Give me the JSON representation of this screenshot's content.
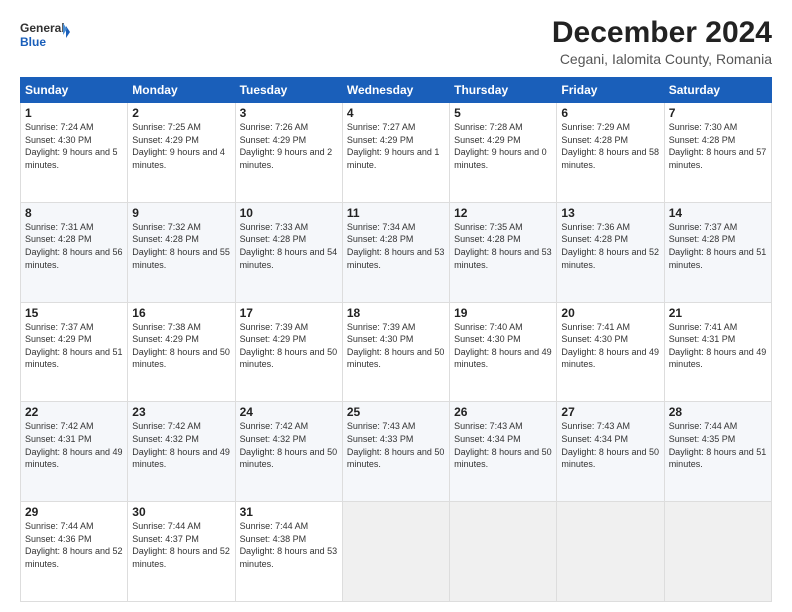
{
  "logo": {
    "line1": "General",
    "line2": "Blue"
  },
  "title": "December 2024",
  "subtitle": "Cegani, Ialomita County, Romania",
  "days_of_week": [
    "Sunday",
    "Monday",
    "Tuesday",
    "Wednesday",
    "Thursday",
    "Friday",
    "Saturday"
  ],
  "weeks": [
    [
      {
        "day": "1",
        "sunrise": "7:24 AM",
        "sunset": "4:30 PM",
        "daylight": "9 hours and 5 minutes."
      },
      {
        "day": "2",
        "sunrise": "7:25 AM",
        "sunset": "4:29 PM",
        "daylight": "9 hours and 4 minutes."
      },
      {
        "day": "3",
        "sunrise": "7:26 AM",
        "sunset": "4:29 PM",
        "daylight": "9 hours and 2 minutes."
      },
      {
        "day": "4",
        "sunrise": "7:27 AM",
        "sunset": "4:29 PM",
        "daylight": "9 hours and 1 minute."
      },
      {
        "day": "5",
        "sunrise": "7:28 AM",
        "sunset": "4:29 PM",
        "daylight": "9 hours and 0 minutes."
      },
      {
        "day": "6",
        "sunrise": "7:29 AM",
        "sunset": "4:28 PM",
        "daylight": "8 hours and 58 minutes."
      },
      {
        "day": "7",
        "sunrise": "7:30 AM",
        "sunset": "4:28 PM",
        "daylight": "8 hours and 57 minutes."
      }
    ],
    [
      {
        "day": "8",
        "sunrise": "7:31 AM",
        "sunset": "4:28 PM",
        "daylight": "8 hours and 56 minutes."
      },
      {
        "day": "9",
        "sunrise": "7:32 AM",
        "sunset": "4:28 PM",
        "daylight": "8 hours and 55 minutes."
      },
      {
        "day": "10",
        "sunrise": "7:33 AM",
        "sunset": "4:28 PM",
        "daylight": "8 hours and 54 minutes."
      },
      {
        "day": "11",
        "sunrise": "7:34 AM",
        "sunset": "4:28 PM",
        "daylight": "8 hours and 53 minutes."
      },
      {
        "day": "12",
        "sunrise": "7:35 AM",
        "sunset": "4:28 PM",
        "daylight": "8 hours and 53 minutes."
      },
      {
        "day": "13",
        "sunrise": "7:36 AM",
        "sunset": "4:28 PM",
        "daylight": "8 hours and 52 minutes."
      },
      {
        "day": "14",
        "sunrise": "7:37 AM",
        "sunset": "4:28 PM",
        "daylight": "8 hours and 51 minutes."
      }
    ],
    [
      {
        "day": "15",
        "sunrise": "7:37 AM",
        "sunset": "4:29 PM",
        "daylight": "8 hours and 51 minutes."
      },
      {
        "day": "16",
        "sunrise": "7:38 AM",
        "sunset": "4:29 PM",
        "daylight": "8 hours and 50 minutes."
      },
      {
        "day": "17",
        "sunrise": "7:39 AM",
        "sunset": "4:29 PM",
        "daylight": "8 hours and 50 minutes."
      },
      {
        "day": "18",
        "sunrise": "7:39 AM",
        "sunset": "4:30 PM",
        "daylight": "8 hours and 50 minutes."
      },
      {
        "day": "19",
        "sunrise": "7:40 AM",
        "sunset": "4:30 PM",
        "daylight": "8 hours and 49 minutes."
      },
      {
        "day": "20",
        "sunrise": "7:41 AM",
        "sunset": "4:30 PM",
        "daylight": "8 hours and 49 minutes."
      },
      {
        "day": "21",
        "sunrise": "7:41 AM",
        "sunset": "4:31 PM",
        "daylight": "8 hours and 49 minutes."
      }
    ],
    [
      {
        "day": "22",
        "sunrise": "7:42 AM",
        "sunset": "4:31 PM",
        "daylight": "8 hours and 49 minutes."
      },
      {
        "day": "23",
        "sunrise": "7:42 AM",
        "sunset": "4:32 PM",
        "daylight": "8 hours and 49 minutes."
      },
      {
        "day": "24",
        "sunrise": "7:42 AM",
        "sunset": "4:32 PM",
        "daylight": "8 hours and 50 minutes."
      },
      {
        "day": "25",
        "sunrise": "7:43 AM",
        "sunset": "4:33 PM",
        "daylight": "8 hours and 50 minutes."
      },
      {
        "day": "26",
        "sunrise": "7:43 AM",
        "sunset": "4:34 PM",
        "daylight": "8 hours and 50 minutes."
      },
      {
        "day": "27",
        "sunrise": "7:43 AM",
        "sunset": "4:34 PM",
        "daylight": "8 hours and 50 minutes."
      },
      {
        "day": "28",
        "sunrise": "7:44 AM",
        "sunset": "4:35 PM",
        "daylight": "8 hours and 51 minutes."
      }
    ],
    [
      {
        "day": "29",
        "sunrise": "7:44 AM",
        "sunset": "4:36 PM",
        "daylight": "8 hours and 52 minutes."
      },
      {
        "day": "30",
        "sunrise": "7:44 AM",
        "sunset": "4:37 PM",
        "daylight": "8 hours and 52 minutes."
      },
      {
        "day": "31",
        "sunrise": "7:44 AM",
        "sunset": "4:38 PM",
        "daylight": "8 hours and 53 minutes."
      },
      null,
      null,
      null,
      null
    ]
  ],
  "labels": {
    "sunrise": "Sunrise:",
    "sunset": "Sunset:",
    "daylight": "Daylight:"
  }
}
